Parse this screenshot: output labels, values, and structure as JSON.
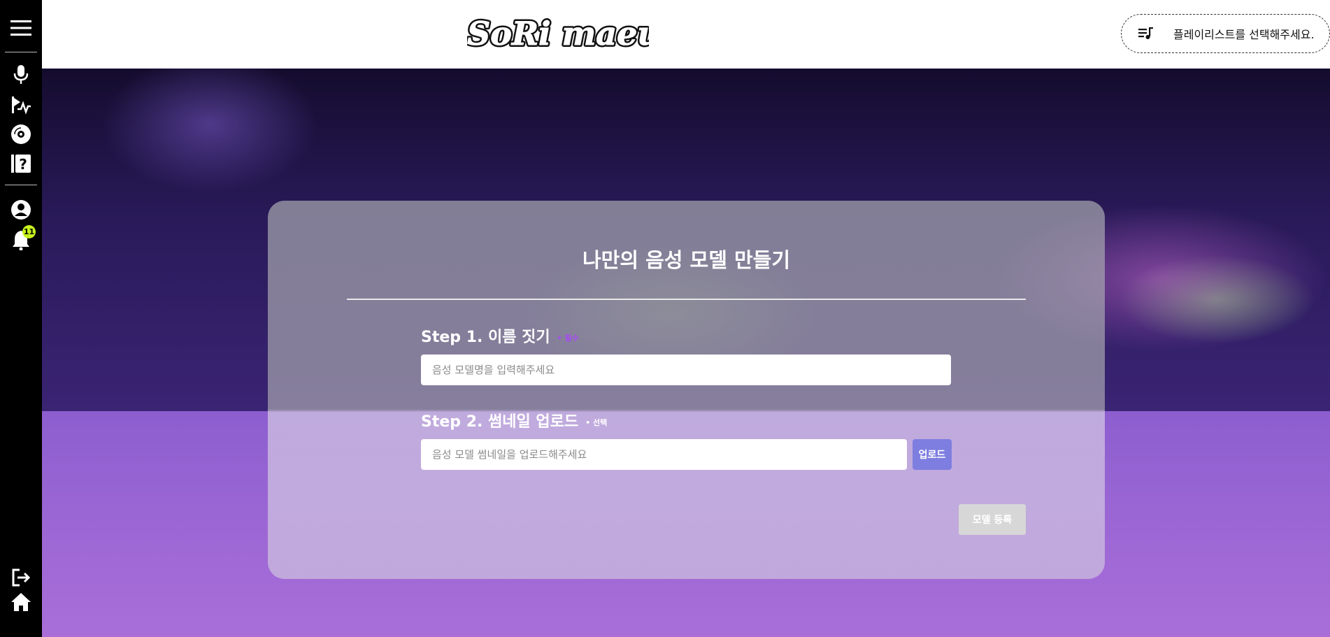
{
  "sidebar": {
    "items": [
      {
        "icon": "hamburger-menu-icon"
      },
      {
        "icon": "microphone-icon"
      },
      {
        "icon": "music-wave-icon"
      },
      {
        "icon": "disc-icon"
      },
      {
        "icon": "help-book-icon"
      },
      {
        "icon": "user-icon"
      },
      {
        "icon": "bell-icon"
      },
      {
        "icon": "logout-icon"
      },
      {
        "icon": "home-icon"
      }
    ],
    "notification_count": "11",
    "badge_color": "#c6f21d"
  },
  "header": {
    "logo_text": "SoRi maeul",
    "playlist_placeholder": "플레이리스트를 선택해주세요."
  },
  "form": {
    "title": "나만의 음성 모델 만들기",
    "step1": {
      "label": "Step 1. 이름 짓기",
      "note": "• 필수",
      "placeholder": "음성 모델명을 입력해주세요",
      "value": ""
    },
    "step2": {
      "label": "Step 2. 썸네일 업로드",
      "note": "• 선택",
      "placeholder": "음성 모델 썸네일을 업로드해주세요",
      "value": "",
      "upload_label": "업로드"
    },
    "submit_label": "모델 등록"
  },
  "colors": {
    "accent": "#7e7ee0",
    "required_note": "#a64bf4",
    "background_purple": "#9a66d4"
  }
}
